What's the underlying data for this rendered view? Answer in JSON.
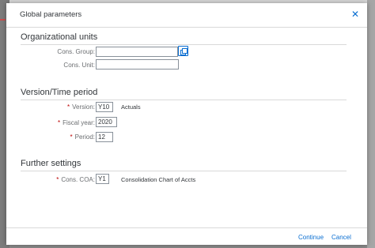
{
  "dialog": {
    "title": "Global parameters",
    "close_icon": "close-icon"
  },
  "sections": {
    "org_units": {
      "title": "Organizational units",
      "cons_group": {
        "label": "Cons. Group:",
        "value": ""
      },
      "cons_unit": {
        "label": "Cons. Unit:",
        "value": ""
      }
    },
    "version_time": {
      "title": "Version/Time period",
      "version": {
        "label": "Version:",
        "value": "Y10",
        "description": "Actuals",
        "required": "*"
      },
      "fiscal_year": {
        "label": "Fiscal year:",
        "value": "2020",
        "required": "*"
      },
      "period": {
        "label": "Period:",
        "value": "12",
        "required": "*"
      }
    },
    "further": {
      "title": "Further settings",
      "cons_coa": {
        "label": "Cons. COA:",
        "value": "Y1",
        "description": "Consolidation Chart of Accts",
        "required": "*"
      }
    }
  },
  "footer": {
    "continue_label": "Continue",
    "cancel_label": "Cancel"
  },
  "colors": {
    "accent": "#0a6ed1",
    "required": "#bb0000",
    "border": "#89919a"
  }
}
